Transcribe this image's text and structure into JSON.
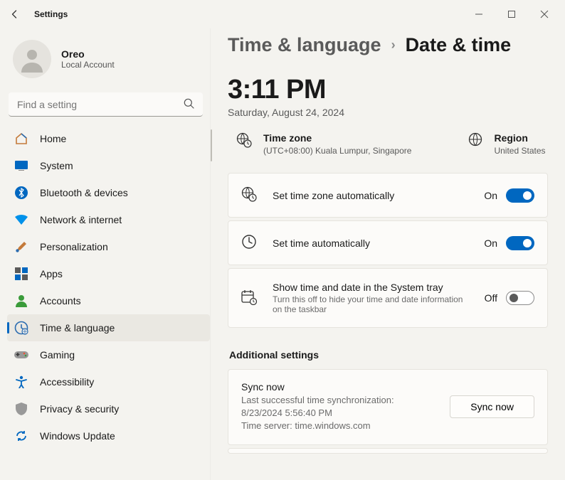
{
  "window": {
    "title": "Settings"
  },
  "account": {
    "name": "Oreo",
    "type": "Local Account"
  },
  "search": {
    "placeholder": "Find a setting"
  },
  "nav": [
    {
      "label": "Home",
      "icon": "home"
    },
    {
      "label": "System",
      "icon": "system"
    },
    {
      "label": "Bluetooth & devices",
      "icon": "bluetooth"
    },
    {
      "label": "Network & internet",
      "icon": "wifi"
    },
    {
      "label": "Personalization",
      "icon": "brush"
    },
    {
      "label": "Apps",
      "icon": "apps"
    },
    {
      "label": "Accounts",
      "icon": "person"
    },
    {
      "label": "Time & language",
      "icon": "clock",
      "selected": true
    },
    {
      "label": "Gaming",
      "icon": "gaming"
    },
    {
      "label": "Accessibility",
      "icon": "accessibility"
    },
    {
      "label": "Privacy & security",
      "icon": "shield"
    },
    {
      "label": "Windows Update",
      "icon": "update"
    }
  ],
  "breadcrumb": {
    "parent": "Time & language",
    "current": "Date & time"
  },
  "clock": {
    "time": "3:11 PM",
    "date": "Saturday, August 24, 2024"
  },
  "timezone": {
    "label": "Time zone",
    "value": "(UTC+08:00) Kuala Lumpur, Singapore"
  },
  "region": {
    "label": "Region",
    "value": "United States"
  },
  "toggles": {
    "tz_auto": {
      "label": "Set time zone automatically",
      "state": "On",
      "on": true
    },
    "time_auto": {
      "label": "Set time automatically",
      "state": "On",
      "on": true
    },
    "systray": {
      "label": "Show time and date in the System tray",
      "sub": "Turn this off to hide your time and date information on the taskbar",
      "state": "Off",
      "on": false
    }
  },
  "additional": {
    "heading": "Additional settings",
    "sync": {
      "title": "Sync now",
      "last_label": "Last successful time synchronization:",
      "last_value": "8/23/2024 5:56:40 PM",
      "server_label": "Time server:",
      "server_value": "time.windows.com",
      "button": "Sync now"
    }
  }
}
